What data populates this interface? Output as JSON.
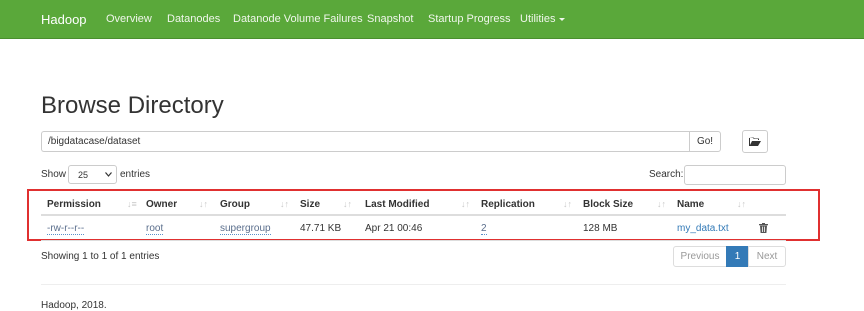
{
  "nav": {
    "brand": "Hadoop",
    "items": [
      "Overview",
      "Datanodes",
      "Datanode Volume Failures",
      "Snapshot",
      "Startup Progress",
      "Utilities"
    ]
  },
  "page_title": "Browse Directory",
  "path": {
    "value": "/bigdatacase/dataset",
    "go_label": "Go!",
    "folder_icon": "folder-open-icon"
  },
  "controls": {
    "show_label": "Show",
    "entries_value": "25",
    "entries_label": "entries",
    "search_label": "Search:"
  },
  "table": {
    "headers": [
      "Permission",
      "Owner",
      "Group",
      "Size",
      "Last Modified",
      "Replication",
      "Block Size",
      "Name"
    ],
    "rows": [
      {
        "permission": "-rw-r--r--",
        "owner": "root",
        "group": "supergroup",
        "size": "47.71 KB",
        "last_modified": "Apr 21 00:46",
        "replication": "2",
        "block_size": "128 MB",
        "name": "my_data.txt",
        "delete_icon": "trash-icon"
      }
    ]
  },
  "info": "Showing 1 to 1 of 1 entries",
  "pagination": {
    "previous": "Previous",
    "current": "1",
    "next": "Next"
  },
  "footer": "Hadoop, 2018.",
  "colors": {
    "navbar": "#5aa83a",
    "highlight": "#e03030",
    "link": "#337ab7"
  }
}
